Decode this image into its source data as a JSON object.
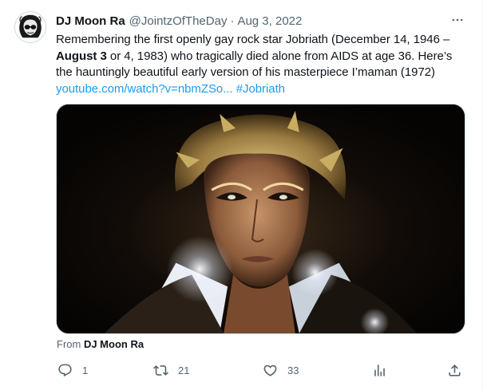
{
  "tweet": {
    "author_name": "DJ Moon Ra",
    "author_handle": "@JointzOfTheDay",
    "separator": "·",
    "date": "Aug 3, 2022",
    "text_part1": "Remembering the first openly gay rock star Jobriath  (December 14, 1946 – ",
    "text_bold": "August 3",
    "text_part2": " or 4, 1983) who tragically died alone from AIDS at age 36. Here’s the hauntingly beautiful early version of his masterpiece I’maman (1972) ",
    "link_text": "youtube.com/watch?v=nbmZSo...",
    "hashtag": "#Jobriath",
    "from_label": "From ",
    "from_name": "DJ Moon Ra"
  },
  "actions": {
    "reply_count": "1",
    "retweet_count": "21",
    "like_count": "33"
  },
  "icons": [
    "more-icon",
    "reply-icon",
    "retweet-icon",
    "like-icon",
    "analytics-icon",
    "share-icon"
  ],
  "colors": {
    "link": "#1d9bf0",
    "secondary_text": "#536471",
    "primary_text": "#0f1419"
  }
}
